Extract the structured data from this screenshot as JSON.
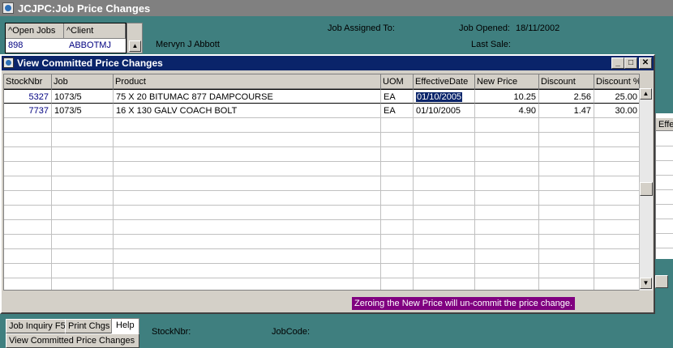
{
  "app": {
    "title": "JCJPC:Job Price Changes"
  },
  "header": {
    "job_assigned_label": "Job Assigned To:",
    "job_opened_label": "Job Opened:",
    "job_opened_value": "18/11/2002",
    "last_sale_label": "Last Sale:",
    "client_name": "Mervyn J Abbott"
  },
  "jobs_grid": {
    "columns": [
      "^Open Jobs",
      "^Client"
    ],
    "row": {
      "job": "898",
      "client": "ABBOTMJ"
    }
  },
  "modal": {
    "title": "View Committed Price Changes",
    "columns": [
      "StockNbr",
      "Job",
      "Product",
      "UOM",
      "EffectiveDate",
      "New Price",
      "Discount",
      "Discount %"
    ],
    "rows": [
      {
        "stock": "5327",
        "job": "1073/5",
        "product": "75 X 20 BITUMAC 877 DAMPCOURSE",
        "uom": "EA",
        "date": "01/10/2005",
        "price": "10.25",
        "discount": "2.56",
        "pct": "25.00"
      },
      {
        "stock": "7737",
        "job": "1073/5",
        "product": "16 X 130 GALV COACH BOLT",
        "uom": "EA",
        "date": "01/10/2005",
        "price": "4.90",
        "discount": "1.47",
        "pct": "30.00"
      }
    ],
    "message": "Zeroing the New Price will un-commit the price change.",
    "colors": {
      "message_bg": "#800080",
      "title_bg": "#0a246a"
    }
  },
  "right_panel": {
    "header_fragment": "Effe"
  },
  "footer": {
    "job_inquiry_button": "Job Inquiry F5",
    "print_button": "Print Chgs",
    "help_tab": "Help",
    "view_button": "View Committed Price Changes",
    "stocknbr_label": "StockNbr:",
    "jobcode_label": "JobCode:"
  }
}
